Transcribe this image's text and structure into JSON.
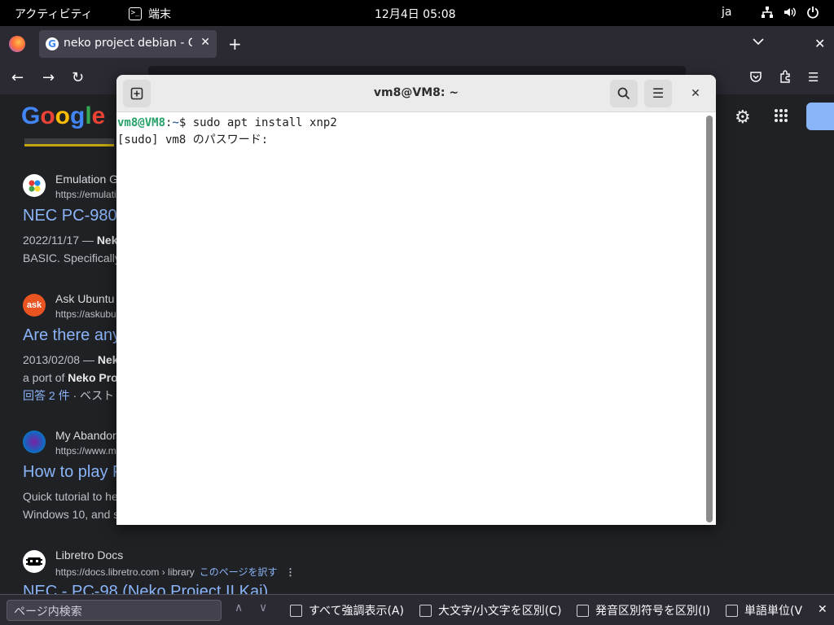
{
  "topbar": {
    "activities": "アクティビティ",
    "app_name": "端末",
    "clock": "12月4日  05:08",
    "input_lang": "ja"
  },
  "browser": {
    "tab_title": "neko project debian - Go",
    "find": {
      "placeholder": "ページ内検索",
      "highlight_all": "すべて強調表示(A)",
      "match_case": "大文字/小文字を区別(C)",
      "match_diacritics": "発音区別符号を区別(I)",
      "whole_words": "単語単位(V"
    }
  },
  "google": {
    "logo": [
      "G",
      "o",
      "o",
      "g",
      "l",
      "e"
    ],
    "results": [
      {
        "site": "Emulation G",
        "url": "https://emulati",
        "fav_text": "",
        "heading": "NEC PC-980",
        "snippet_date": "2022/11/17 — ",
        "snippet_bold": "Neko",
        "snippet_line2": "BASIC. Specifically"
      },
      {
        "site": "Ask Ubuntu",
        "url": "https://askubu",
        "fav_text": "ask",
        "heading": "Are there any",
        "snippet_date": "2013/02/08 — ",
        "snippet_bold": "Nek",
        "snippet_line2_pre": "a port of ",
        "snippet_line2_bold": "Neko Pro",
        "answers": "回答 2 件",
        "answers_tail": " · ベスト"
      },
      {
        "site": "My Abandor",
        "url": "https://www.m",
        "fav_text": "",
        "heading": "How to play F",
        "snippet_line1": "Quick tutorial to he",
        "snippet_line2": "Windows 10, and s"
      },
      {
        "site": "Libretro Docs",
        "url": "https://docs.libretro.com › library",
        "translate": "このページを訳す",
        "fav_text": "",
        "heading": "NEC - PC-98 (Neko Project II Kai)"
      }
    ]
  },
  "terminal": {
    "title": "vm8@VM8: ~",
    "prompt_user": "vm8@VM8",
    "prompt_sep": ":",
    "prompt_path": "~",
    "prompt_sym": "$ ",
    "command": "sudo apt install xnp2",
    "line2": "[sudo] vm8 のパスワード:"
  },
  "icons": {
    "terminal_app": "terminal-icon",
    "network": "network-icon",
    "volume": "volume-icon",
    "power": "power-icon"
  }
}
